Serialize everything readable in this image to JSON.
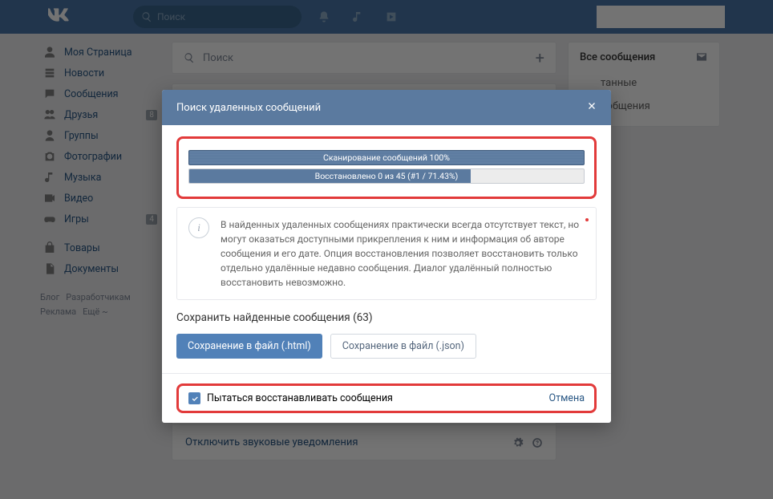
{
  "topbar": {
    "search_placeholder": "Поиск"
  },
  "sidebar": {
    "items": [
      {
        "label": "Моя Страница",
        "badge": null
      },
      {
        "label": "Новости",
        "badge": null
      },
      {
        "label": "Сообщения",
        "badge": null
      },
      {
        "label": "Друзья",
        "badge": "8"
      },
      {
        "label": "Группы",
        "badge": null
      },
      {
        "label": "Фотографии",
        "badge": null
      },
      {
        "label": "Музыка",
        "badge": null
      },
      {
        "label": "Видео",
        "badge": null
      },
      {
        "label": "Игры",
        "badge": "4"
      },
      {
        "label": "Товары",
        "badge": null
      },
      {
        "label": "Документы",
        "badge": null
      }
    ],
    "footer": {
      "blog": "Блог",
      "devs": "Разработчикам",
      "ads": "Реклама",
      "more": "Ещё ~"
    }
  },
  "center": {
    "search_placeholder": "Поиск",
    "sound_off": "Отключить звуковые уведомления"
  },
  "right": {
    "all": "Все сообщения",
    "unread_tail": "танные",
    "groups_tail": "ообщения"
  },
  "modal": {
    "title": "Поиск удаленных сообщений",
    "progress1": "Сканирование сообщений 100%",
    "progress2": "Восстановлено 0 из 45 (#1 / 71.43%)",
    "progress2_width": "71.43%",
    "info": "В найденных удаленных сообщениях практически всегда отсутствует текст, но могут оказаться доступными прикрепления к ним и информация об авторе сообщения и его дате. Опция восстановления позволяет восстановить только отдельно удалённые недавно сообщения. Диалог удалённый полностью восстановить невозможно.",
    "save_title": "Сохранить найденные сообщения (63)",
    "btn_html": "Сохранение в файл (.html)",
    "btn_json": "Сохранение в файл (.json)",
    "checkbox_label": "Пытаться восстанавливать сообщения",
    "cancel": "Отмена"
  }
}
